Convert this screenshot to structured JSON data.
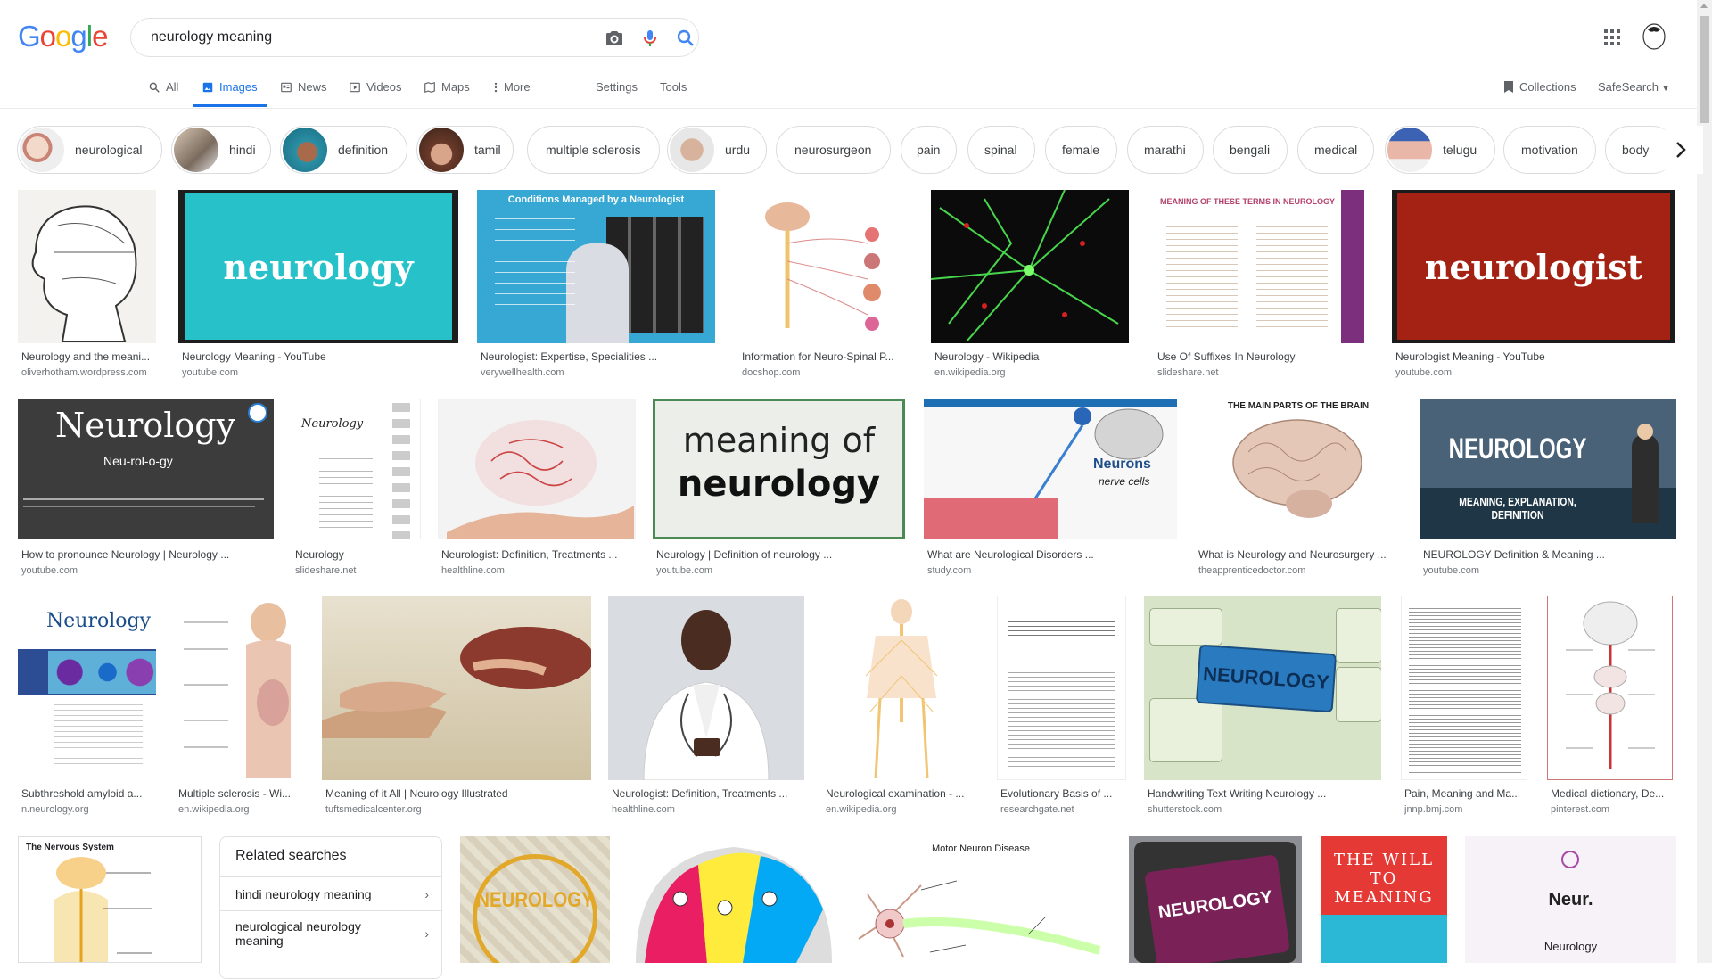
{
  "logo": {
    "letters": [
      "G",
      "o",
      "o",
      "g",
      "l",
      "e"
    ],
    "colors": [
      "#4285F4",
      "#EA4335",
      "#FBBC05",
      "#4285F4",
      "#34A853",
      "#EA4335"
    ]
  },
  "search": {
    "query": "neurology meaning",
    "icons": [
      "camera-icon",
      "mic-icon",
      "search-icon"
    ]
  },
  "tabs": [
    {
      "label": "All",
      "icon": "search-icon"
    },
    {
      "label": "Images",
      "icon": "image-icon",
      "active": true
    },
    {
      "label": "News",
      "icon": "news-icon"
    },
    {
      "label": "Videos",
      "icon": "video-icon"
    },
    {
      "label": "Maps",
      "icon": "map-icon"
    },
    {
      "label": "More",
      "icon": "more-vert-icon"
    },
    {
      "label": "Settings"
    },
    {
      "label": "Tools"
    }
  ],
  "right_tools": {
    "collections": "Collections",
    "safesearch": "SafeSearch"
  },
  "chips": [
    {
      "label": "neurological",
      "has_thumb": true
    },
    {
      "label": "hindi",
      "has_thumb": true
    },
    {
      "label": "definition",
      "has_thumb": true
    },
    {
      "label": "tamil",
      "has_thumb": true
    },
    {
      "label": "multiple sclerosis",
      "has_thumb": false
    },
    {
      "label": "urdu",
      "has_thumb": true
    },
    {
      "label": "neurosurgeon",
      "has_thumb": false
    },
    {
      "label": "pain",
      "has_thumb": false
    },
    {
      "label": "spinal",
      "has_thumb": false
    },
    {
      "label": "female",
      "has_thumb": false
    },
    {
      "label": "marathi",
      "has_thumb": false
    },
    {
      "label": "bengali",
      "has_thumb": false
    },
    {
      "label": "medical",
      "has_thumb": false
    },
    {
      "label": "telugu",
      "has_thumb": true
    },
    {
      "label": "motivation",
      "has_thumb": false
    },
    {
      "label": "body",
      "has_thumb": false
    }
  ],
  "results": {
    "row1": [
      {
        "title": "Neurology and the meani...",
        "source": "oliverhotham.wordpress.com"
      },
      {
        "title": "Neurology Meaning - YouTube",
        "source": "youtube.com",
        "image_text": "neurology"
      },
      {
        "title": "Neurologist: Expertise, Specialities ...",
        "source": "verywellhealth.com",
        "image_text": "Conditions Managed by a Neurologist"
      },
      {
        "title": "Information for Neuro-Spinal P...",
        "source": "docshop.com"
      },
      {
        "title": "Neurology - Wikipedia",
        "source": "en.wikipedia.org"
      },
      {
        "title": "Use Of Suffixes In Neurology",
        "source": "slideshare.net",
        "image_text": "MEANING OF THESE TERMS IN NEUROLOGY"
      },
      {
        "title": "Neurologist Meaning - YouTube",
        "source": "youtube.com",
        "image_text": "neurologist"
      }
    ],
    "row2": [
      {
        "title": "How to pronounce Neurology | Neurology ...",
        "source": "youtube.com",
        "image_text": "Neurology",
        "image_sub": "Neu-rol-o-gy"
      },
      {
        "title": "Neurology",
        "source": "slideshare.net",
        "image_text": "Neurology"
      },
      {
        "title": "Neurologist: Definition, Treatments ...",
        "source": "healthline.com"
      },
      {
        "title": "Neurology | Definition of neurology ...",
        "source": "youtube.com",
        "image_text": "meaning of",
        "image_sub": "neurology"
      },
      {
        "title": "What are Neurological Disorders ...",
        "source": "study.com",
        "image_text": "Neurons",
        "image_sub": "nerve cells"
      },
      {
        "title": "What is Neurology and Neurosurgery ...",
        "source": "theapprenticedoctor.com",
        "image_text": "THE MAIN PARTS OF THE BRAIN"
      },
      {
        "title": "NEUROLOGY Definition & Meaning ...",
        "source": "youtube.com",
        "image_text": "NEUROLOGY",
        "image_sub": "MEANING, EXPLANATION, DEFINITION"
      }
    ],
    "row3": [
      {
        "title": "Subthreshold amyloid a...",
        "source": "n.neurology.org",
        "image_text": "Neurology"
      },
      {
        "title": "Multiple sclerosis - Wi...",
        "source": "en.wikipedia.org"
      },
      {
        "title": "Meaning of it All | Neurology Illustrated",
        "source": "tuftsmedicalcenter.org"
      },
      {
        "title": "Neurologist: Definition, Treatments ...",
        "source": "healthline.com"
      },
      {
        "title": "Neurological examination - ...",
        "source": "en.wikipedia.org"
      },
      {
        "title": "Evolutionary Basis of ...",
        "source": "researchgate.net"
      },
      {
        "title": "Handwriting Text Writing Neurology ...",
        "source": "shutterstock.com",
        "image_text": "NEUROLOGY"
      },
      {
        "title": "Pain, Meaning and Ma...",
        "source": "jnnp.bmj.com"
      },
      {
        "title": "Medical dictionary, De...",
        "source": "pinterest.com"
      }
    ],
    "row4": [
      {
        "image_text": "The Nervous System"
      },
      {
        "image_text": "NEUROLOGY"
      },
      {
        "image_text": ""
      },
      {
        "image_text": "Motor Neuron Disease"
      },
      {
        "image_text": "NEUROLOGY"
      },
      {
        "image_text": "THE WILL TO MEANING"
      },
      {
        "image_text": "Neur.",
        "image_sub": "Neurology"
      }
    ]
  },
  "related": {
    "title": "Related searches",
    "items": [
      "hindi neurology meaning",
      "neurological neurology meaning"
    ]
  }
}
